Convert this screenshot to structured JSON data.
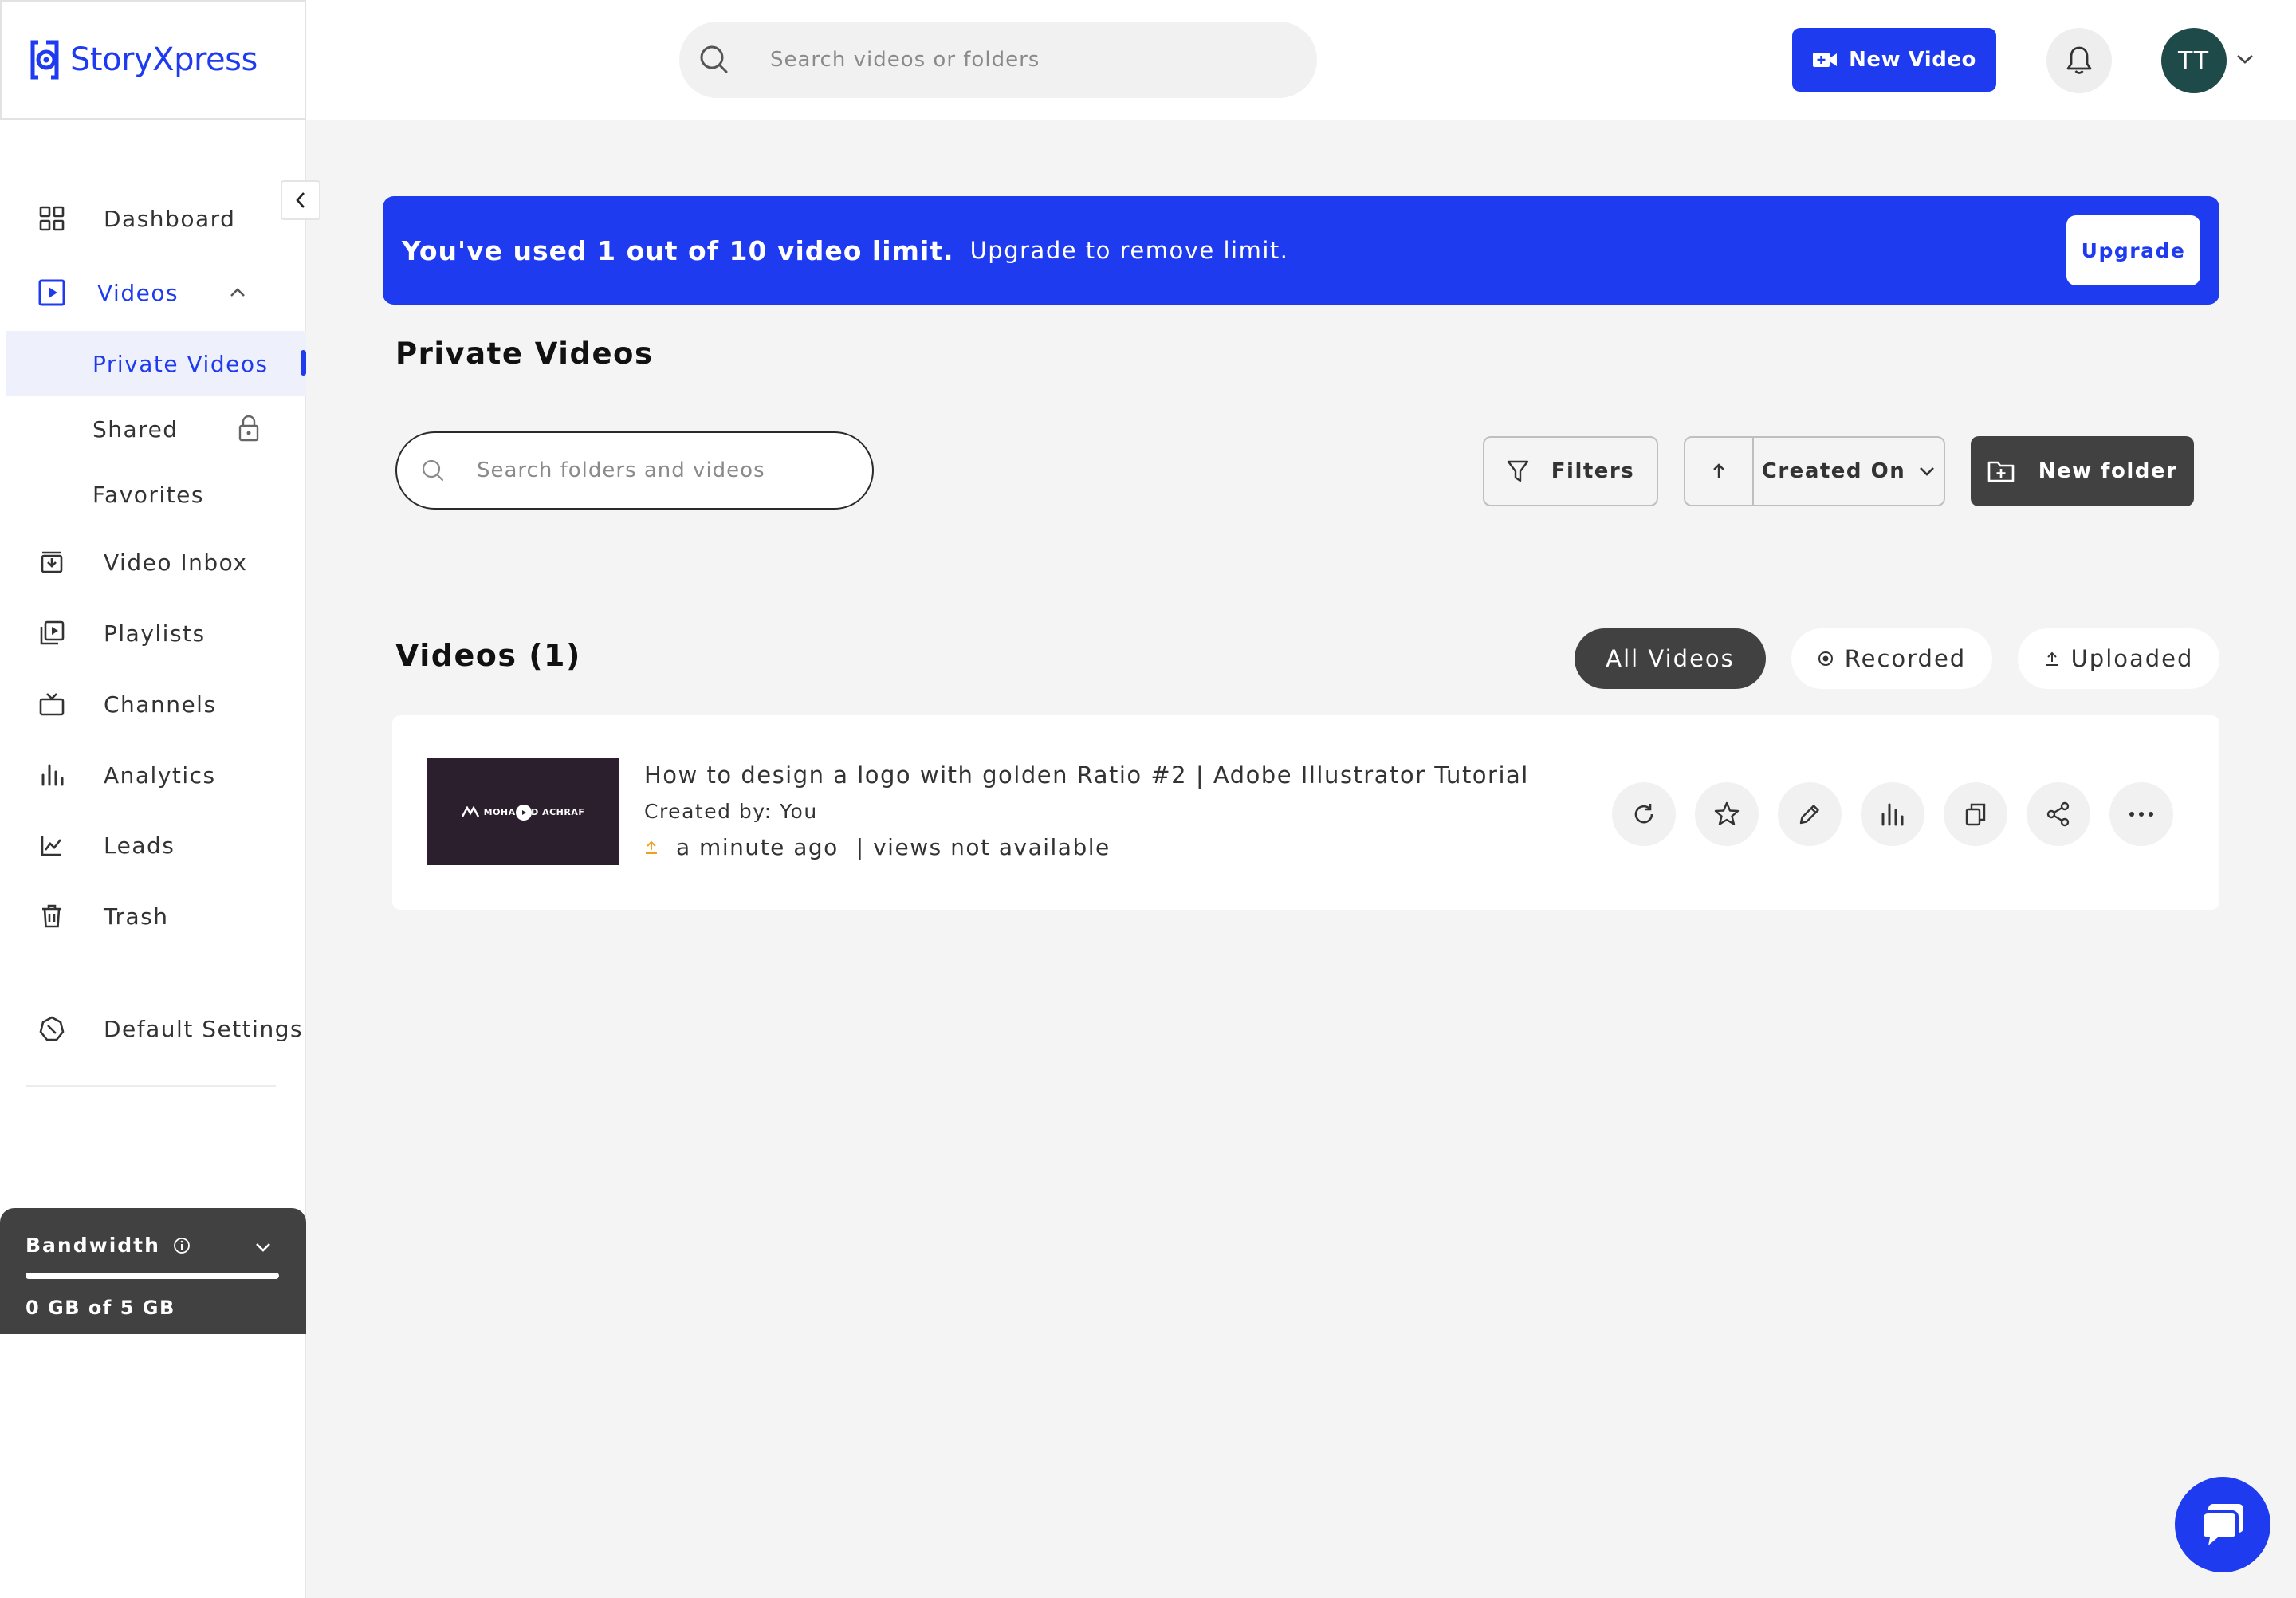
{
  "app": {
    "name": "StoryXpress"
  },
  "header": {
    "search_placeholder": "Search videos or folders",
    "new_video_label": "New Video",
    "avatar_initials": "TT"
  },
  "sidebar": {
    "items": [
      {
        "label": "Dashboard",
        "icon": "dashboard-grid-icon"
      },
      {
        "label": "Videos",
        "icon": "video-play-icon",
        "expanded": true
      },
      {
        "label": "Video Inbox",
        "icon": "inbox-icon"
      },
      {
        "label": "Playlists",
        "icon": "playlist-icon"
      },
      {
        "label": "Channels",
        "icon": "tv-icon"
      },
      {
        "label": "Analytics",
        "icon": "bar-chart-icon"
      },
      {
        "label": "Leads",
        "icon": "line-chart-icon"
      },
      {
        "label": "Trash",
        "icon": "trash-icon"
      },
      {
        "label": "Default Settings",
        "icon": "settings-badge-icon"
      }
    ],
    "sub_items": [
      {
        "label": "Private Videos",
        "active": true
      },
      {
        "label": "Shared",
        "icon": "lock-icon"
      },
      {
        "label": "Favorites"
      }
    ],
    "bandwidth": {
      "title": "Bandwidth",
      "usage_text": "0 GB of 5 GB",
      "used_fraction": 0
    }
  },
  "banner": {
    "main_text": "You've used 1 out of 10 video limit.",
    "sub_text": "Upgrade to remove limit.",
    "upgrade_label": "Upgrade"
  },
  "page": {
    "title": "Private Videos",
    "folder_search_placeholder": "Search folders and videos",
    "filters_label": "Filters",
    "sort_field": "Created On",
    "sort_direction": "ascending",
    "new_folder_label": "New folder"
  },
  "videos": {
    "section_title": "Videos (1)",
    "tabs": [
      {
        "label": "All Videos",
        "active": true
      },
      {
        "label": "Recorded",
        "icon": "record-icon"
      },
      {
        "label": "Uploaded",
        "icon": "upload-icon"
      }
    ],
    "items": [
      {
        "title": "How to design a logo with golden Ratio #2 | Adobe Illustrator Tutorial",
        "created_by": "Created by: You",
        "time": "a minute ago",
        "views": "| views not available",
        "thumbnail_text": "MOHAMED ACHRAF"
      }
    ],
    "actions": [
      "refresh-icon",
      "star-icon",
      "edit-pencil-icon",
      "analytics-bars-icon",
      "copy-icon",
      "share-icon",
      "more-dots-icon"
    ]
  },
  "colors": {
    "brand": "#1f3bf0",
    "dark_button": "#414141",
    "background": "#f4f4f4",
    "avatar": "#1f4a4a"
  }
}
